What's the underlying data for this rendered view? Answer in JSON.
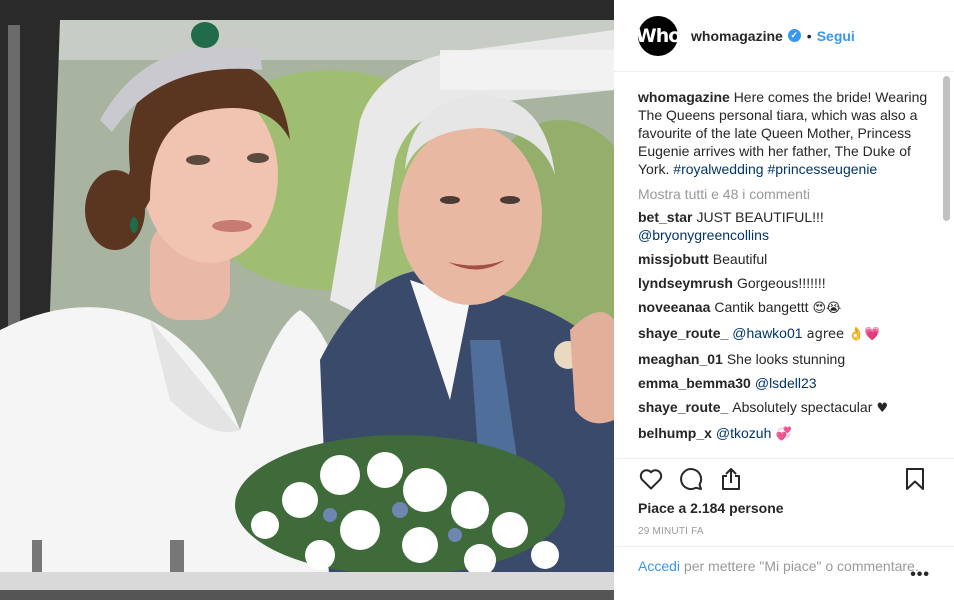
{
  "header": {
    "avatar_text": "Who",
    "username": "whomagazine",
    "verified_mark": "✓",
    "separator": "•",
    "follow_label": "Segui"
  },
  "caption": {
    "username": "whomagazine",
    "text": "Here comes the bride! Wearing The Queens personal tiara, which was also a favourite of the late Queen Mother, Princess Eugenie arrives with her father, The Duke of York.",
    "hashtag1": "#royalwedding",
    "hashtag2": "#princesseugenie"
  },
  "view_all_comments": "Mostra tutti e 48 i commenti",
  "comments": [
    {
      "user": "bet_star",
      "text": "JUST BEAUTIFUL!!!",
      "mention": "@bryonygreencollins",
      "suffix": ""
    },
    {
      "user": "missjobutt",
      "text": "Beautiful",
      "mention": "",
      "suffix": ""
    },
    {
      "user": "lyndseymrush",
      "text": "Gorgeous!!!!!!!",
      "mention": "",
      "suffix": ""
    },
    {
      "user": "noveeanaa",
      "text": "Cantik bangettt",
      "mention": "",
      "suffix": "😍😭"
    },
    {
      "user": "shaye_route_",
      "text": "",
      "mention": "@hawko01",
      "suffix": " agree 👌💗"
    },
    {
      "user": "meaghan_01",
      "text": "She looks stunning",
      "mention": "",
      "suffix": ""
    },
    {
      "user": "emma_bemma30",
      "text": "",
      "mention": "@lsdell23",
      "suffix": ""
    },
    {
      "user": "shaye_route_",
      "text": "Absolutely spectacular",
      "mention": "",
      "suffix": " ♥"
    },
    {
      "user": "belhump_x",
      "text": "",
      "mention": "@tkozuh",
      "suffix": " 💞"
    }
  ],
  "actions": {
    "like_icon": "heart-icon",
    "comment_icon": "speech-bubble-icon",
    "share_icon": "share-icon",
    "save_icon": "bookmark-icon"
  },
  "likes_text": "Piace a 2.184 persone",
  "timestamp": "29 MINUTI FA",
  "login_prompt": {
    "link": "Accedi",
    "text": " per mettere \"Mi piace\" o commentare."
  },
  "more_label": "•••",
  "colors": {
    "link_blue": "#3897f0",
    "hashtag_blue": "#003569",
    "muted_gray": "#999999",
    "text": "#262626"
  }
}
